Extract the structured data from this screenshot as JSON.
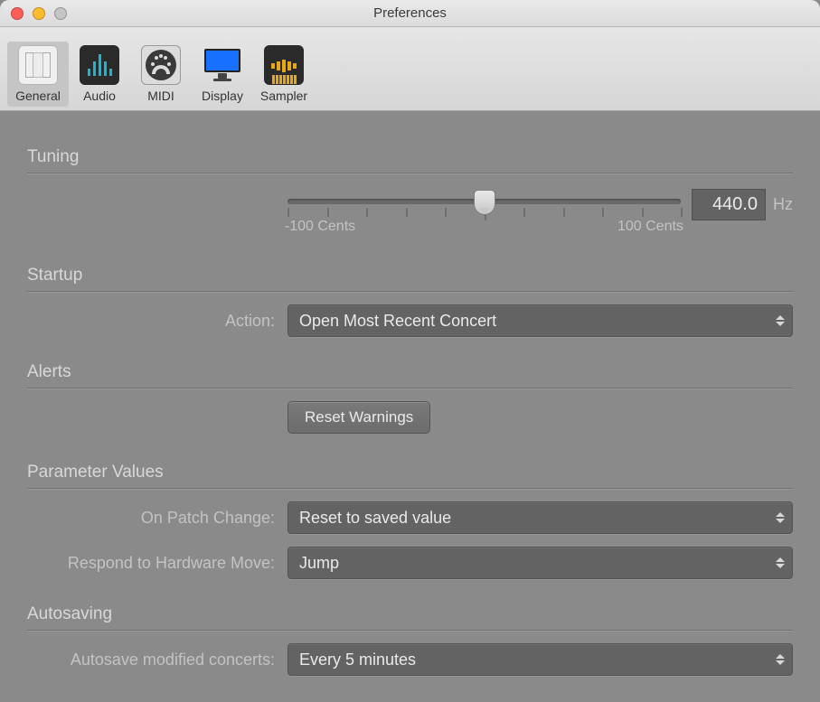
{
  "window": {
    "title": "Preferences"
  },
  "toolbar": {
    "tabs": [
      {
        "id": "general",
        "label": "General",
        "selected": true
      },
      {
        "id": "audio",
        "label": "Audio"
      },
      {
        "id": "midi",
        "label": "MIDI"
      },
      {
        "id": "display",
        "label": "Display"
      },
      {
        "id": "sampler",
        "label": "Sampler"
      }
    ]
  },
  "sections": {
    "tuning": {
      "title": "Tuning",
      "slider": {
        "min_label": "-100 Cents",
        "max_label": "100 Cents"
      },
      "value": "440.0",
      "unit": "Hz"
    },
    "startup": {
      "title": "Startup",
      "action_label": "Action:",
      "action_value": "Open Most Recent Concert"
    },
    "alerts": {
      "title": "Alerts",
      "button_label": "Reset Warnings"
    },
    "parameters": {
      "title": "Parameter Values",
      "on_patch_change_label": "On Patch Change:",
      "on_patch_change_value": "Reset to saved value",
      "respond_hw_label": "Respond to Hardware Move:",
      "respond_hw_value": "Jump"
    },
    "autosaving": {
      "title": "Autosaving",
      "label": "Autosave modified concerts:",
      "value": "Every 5 minutes"
    }
  }
}
